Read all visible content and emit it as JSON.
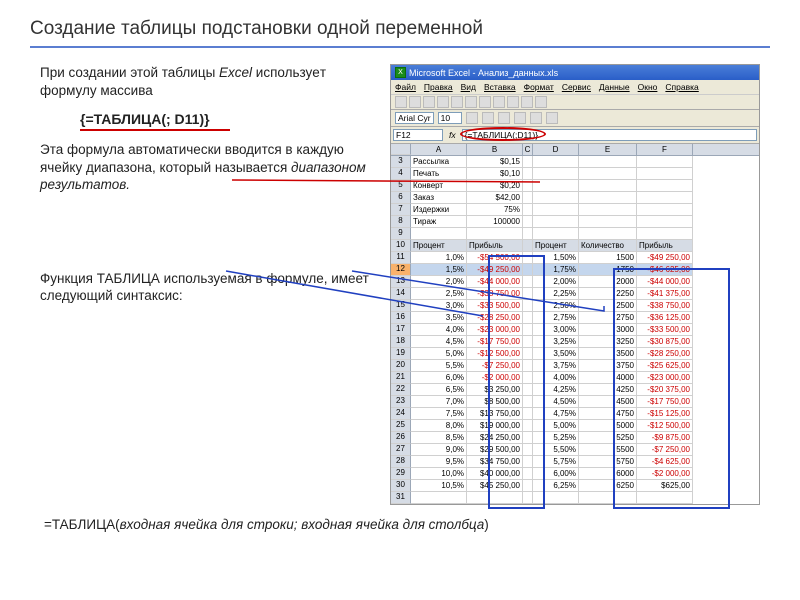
{
  "title": "Создание таблицы подстановки одной переменной",
  "para1a": "При создании этой таблицы ",
  "para1b": "Excel",
  "para1c": " используeт формулу массива",
  "formula": "{=ТАБЛИЦА(; D11)}",
  "para2a": "Эта формула автоматически вводится в каждую ячейку диапазона, который называется ",
  "para2b": "диапазоном результатов.",
  "para3": "Функция ТАБЛИЦА используемая в формуле, имеет следующий синтаксис:",
  "syntax_a": "=ТАБЛИЦА(",
  "syntax_b": "входная ячейка для строки; входная ячейка для столбца",
  "syntax_c": ")",
  "excel": {
    "app_title": "Microsoft Excel - Анализ_данных.xls",
    "menu": [
      "Файл",
      "Правка",
      "Вид",
      "Вставка",
      "Формат",
      "Сервис",
      "Данные",
      "Окно",
      "Справка"
    ],
    "font": "Arial Cyr",
    "size": "10",
    "cellref": "F12",
    "formula_value": "{=ТАБЛИЦА(;D11)}",
    "cols": [
      "A",
      "B",
      "C",
      "D",
      "E",
      "F"
    ],
    "top_rows": [
      {
        "n": "3",
        "a": "Рассылка",
        "b": "$0,15"
      },
      {
        "n": "4",
        "a": "Печать",
        "b": "$0,10"
      },
      {
        "n": "5",
        "a": "Конверт",
        "b": "$0,20"
      },
      {
        "n": "6",
        "a": "Заказ",
        "b": "$42,00"
      },
      {
        "n": "7",
        "a": "Издержки",
        "b": "75%"
      },
      {
        "n": "8",
        "a": "Тираж",
        "b": "100000"
      }
    ],
    "headers": {
      "a": "Процент",
      "b": "Прибыль",
      "d": "Процент",
      "e": "Количество",
      "f": "Прибыль"
    },
    "data_rows": [
      {
        "n": "11",
        "a": "1,0%",
        "b": "-$54 500,00",
        "d": "1,50%",
        "e": "1500",
        "f": "-$49 250,00",
        "bn": true,
        "fn": true
      },
      {
        "n": "12",
        "a": "1,5%",
        "b": "-$49 250,00",
        "d": "1,75%",
        "e": "1750",
        "f": "-$46 625,00",
        "bn": true,
        "fn": true,
        "sel": true
      },
      {
        "n": "13",
        "a": "2,0%",
        "b": "-$44 000,00",
        "d": "2,00%",
        "e": "2000",
        "f": "-$44 000,00",
        "bn": true,
        "fn": true
      },
      {
        "n": "14",
        "a": "2,5%",
        "b": "-$38 750,00",
        "d": "2,25%",
        "e": "2250",
        "f": "-$41 375,00",
        "bn": true,
        "fn": true
      },
      {
        "n": "15",
        "a": "3,0%",
        "b": "-$33 500,00",
        "d": "2,50%",
        "e": "2500",
        "f": "-$38 750,00",
        "bn": true,
        "fn": true
      },
      {
        "n": "16",
        "a": "3,5%",
        "b": "-$28 250,00",
        "d": "2,75%",
        "e": "2750",
        "f": "-$36 125,00",
        "bn": true,
        "fn": true
      },
      {
        "n": "17",
        "a": "4,0%",
        "b": "-$23 000,00",
        "d": "3,00%",
        "e": "3000",
        "f": "-$33 500,00",
        "bn": true,
        "fn": true
      },
      {
        "n": "18",
        "a": "4,5%",
        "b": "-$17 750,00",
        "d": "3,25%",
        "e": "3250",
        "f": "-$30 875,00",
        "bn": true,
        "fn": true
      },
      {
        "n": "19",
        "a": "5,0%",
        "b": "-$12 500,00",
        "d": "3,50%",
        "e": "3500",
        "f": "-$28 250,00",
        "bn": true,
        "fn": true
      },
      {
        "n": "20",
        "a": "5,5%",
        "b": "-$7 250,00",
        "d": "3,75%",
        "e": "3750",
        "f": "-$25 625,00",
        "bn": true,
        "fn": true
      },
      {
        "n": "21",
        "a": "6,0%",
        "b": "-$2 000,00",
        "d": "4,00%",
        "e": "4000",
        "f": "-$23 000,00",
        "bn": true,
        "fn": true
      },
      {
        "n": "22",
        "a": "6,5%",
        "b": "$3 250,00",
        "d": "4,25%",
        "e": "4250",
        "f": "-$20 375,00",
        "bn": false,
        "fn": true
      },
      {
        "n": "23",
        "a": "7,0%",
        "b": "$8 500,00",
        "d": "4,50%",
        "e": "4500",
        "f": "-$17 750,00",
        "bn": false,
        "fn": true
      },
      {
        "n": "24",
        "a": "7,5%",
        "b": "$13 750,00",
        "d": "4,75%",
        "e": "4750",
        "f": "-$15 125,00",
        "bn": false,
        "fn": true
      },
      {
        "n": "25",
        "a": "8,0%",
        "b": "$19 000,00",
        "d": "5,00%",
        "e": "5000",
        "f": "-$12 500,00",
        "bn": false,
        "fn": true
      },
      {
        "n": "26",
        "a": "8,5%",
        "b": "$24 250,00",
        "d": "5,25%",
        "e": "5250",
        "f": "-$9 875,00",
        "bn": false,
        "fn": true
      },
      {
        "n": "27",
        "a": "9,0%",
        "b": "$29 500,00",
        "d": "5,50%",
        "e": "5500",
        "f": "-$7 250,00",
        "bn": false,
        "fn": true
      },
      {
        "n": "28",
        "a": "9,5%",
        "b": "$34 750,00",
        "d": "5,75%",
        "e": "5750",
        "f": "-$4 625,00",
        "bn": false,
        "fn": true
      },
      {
        "n": "29",
        "a": "10,0%",
        "b": "$40 000,00",
        "d": "6,00%",
        "e": "6000",
        "f": "-$2 000,00",
        "bn": false,
        "fn": true
      },
      {
        "n": "30",
        "a": "10,5%",
        "b": "$45 250,00",
        "d": "6,25%",
        "e": "6250",
        "f": "$625,00",
        "bn": false,
        "fn": false
      }
    ],
    "last_row": "31"
  }
}
